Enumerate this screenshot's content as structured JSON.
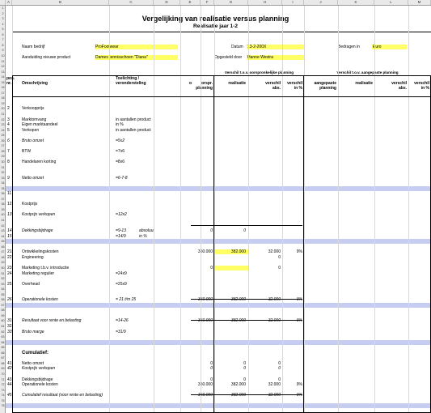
{
  "columns": [
    "A",
    "B",
    "C",
    "D",
    "E",
    "F",
    "G",
    "H",
    "I",
    "J",
    "K",
    "L",
    "M"
  ],
  "title": "Vergelijking van realisatie versus planning",
  "subtitle": "Realisatie jaar 1-2",
  "form": {
    "bedrijf_label": "Naam bedrijf",
    "bedrijf_value": "ProFootwear",
    "product_label": "Aanduiding nieuwe product",
    "product_value": "Dames tennisschoen \"Diana\"",
    "datum_label": "Datum",
    "datum_value": "13-2-200X",
    "opgesteld_label": "Opgesteld door",
    "opgesteld_value": "Hanne Westra",
    "bedragen_label": "Bedragen in",
    "bedragen_value": "Euro"
  },
  "headers": {
    "verschil_oorspr": "Verschil t.o.v. oorspronkelijke planning",
    "verschil_aangepast": "Verschil t.o.v. aangepaste planning",
    "pos": "pos.",
    "nr": "nr.",
    "omschrijving": "Omschrijving",
    "toelichting1": "Toelichting /",
    "toelichting2": "verondersteling",
    "o": "o",
    "orspr1": "orspr.",
    "orspr2": "planning",
    "realisatie": "realisatie",
    "verschil": "verschil",
    "abs": "abs.",
    "in_pct": "in %",
    "aangepaste1": "aangepaste",
    "aangepaste2": "planning"
  },
  "rows": [
    {
      "r": "1"
    },
    {
      "r": "2"
    },
    {
      "r": "3"
    },
    {
      "r": "4"
    },
    {
      "r": "5"
    },
    {
      "r": "6"
    },
    {
      "r": "7"
    },
    {
      "r": "8"
    },
    {
      "r": "9"
    },
    {
      "r": "10"
    },
    {
      "r": "11"
    },
    {
      "r": "12"
    },
    {
      "r": "13"
    },
    {
      "r": "14"
    },
    {
      "r": "15"
    },
    {
      "r": "16"
    },
    {
      "r": "17"
    },
    {
      "r": "18"
    },
    {
      "r": "19"
    },
    {
      "r": "20",
      "pos": "2",
      "desc": "Verkoopprijs"
    },
    {
      "r": "21"
    },
    {
      "r": "22",
      "pos": "3",
      "desc": "Marktomvang",
      "note": "in aantallen product"
    },
    {
      "r": "23",
      "pos": "4",
      "desc": "Eigen marktaandeel",
      "note": "in %"
    },
    {
      "r": "24",
      "pos": "5",
      "desc": "Verkopen",
      "note": "in aantallen product"
    },
    {
      "r": "25"
    },
    {
      "r": "26",
      "pos": "6",
      "desc": "Bruto omzet",
      "formula": "=5x2",
      "italic": true
    },
    {
      "r": "27"
    },
    {
      "r": "28",
      "pos": "7",
      "desc": "BTW",
      "formula": "=7x6"
    },
    {
      "r": "29"
    },
    {
      "r": "30",
      "pos": "8",
      "desc": "Handelaren korting",
      "formula": "=8x6"
    },
    {
      "r": "31"
    },
    {
      "r": "32"
    },
    {
      "r": "33",
      "pos": "9",
      "desc": "Netto omzet",
      "formula": "=6-7-8",
      "italic": true
    },
    {
      "r": "34"
    },
    {
      "r": "35",
      "band": true
    },
    {
      "r": "36",
      "pos": "11"
    },
    {
      "r": "37"
    },
    {
      "r": "38",
      "pos": "12",
      "desc": "Kostprijs"
    },
    {
      "r": "39"
    },
    {
      "r": "40",
      "pos": "13",
      "desc": "Kostprijs verkopen",
      "formula": "=12x2",
      "italic": true
    },
    {
      "r": "41"
    },
    {
      "r": "42"
    },
    {
      "r": "43",
      "pos": "14",
      "desc": "Dekkingsbijdrage",
      "formula": "=9-13",
      "extra": "absoluut",
      "italic": true,
      "f": "0",
      "g": "0"
    },
    {
      "r": "44",
      "pos": "15",
      "formula": "=14/9",
      "extra": "in %",
      "italic": true
    },
    {
      "r": "45",
      "band": true
    },
    {
      "r": "46"
    },
    {
      "r": "47",
      "pos": "21",
      "desc": "Ontwikkelingskosten",
      "f": "350.000",
      "g": "382.000",
      "h": "32.000",
      "i": "9%",
      "yellow": true
    },
    {
      "r": "48",
      "pos": "22",
      "desc": "Engineering",
      "h": "0"
    },
    {
      "r": "49"
    },
    {
      "r": "50",
      "pos": "23",
      "desc": "Marketing t.b.v. introductie",
      "f": "0",
      "h": "0",
      "yellow": true
    },
    {
      "r": "51",
      "pos": "24",
      "desc": "Marketing regulier",
      "formula": "=24x9"
    },
    {
      "r": "52"
    },
    {
      "r": "53",
      "pos": "25",
      "desc": "Overhead",
      "formula": "=25x9"
    },
    {
      "r": "54"
    },
    {
      "r": "55"
    },
    {
      "r": "56",
      "pos": "26",
      "desc": "Operationele kosten",
      "formula": "= 21 t/m 25",
      "italic": true,
      "f": "350.000",
      "g": "382.000",
      "h": "32.000",
      "i": "9%"
    },
    {
      "r": "57",
      "band": true
    },
    {
      "r": "58"
    },
    {
      "r": "59"
    },
    {
      "r": "60",
      "pos": "31",
      "desc": "Resultaat voor rente en belasting",
      "formula": "=14-26",
      "italic": true,
      "f": "-350.000",
      "g": "-382.000",
      "h": "-32.000",
      "i": "9%"
    },
    {
      "r": "61",
      "pos": "32"
    },
    {
      "r": "62",
      "pos": "33",
      "desc": "Bruto marge",
      "formula": "=31/9",
      "italic": true
    },
    {
      "r": "63"
    },
    {
      "r": "64",
      "band": true
    },
    {
      "r": "65"
    },
    {
      "r": "66",
      "desc": "Cumulatief:",
      "bold": true,
      "big": true
    },
    {
      "r": "67"
    },
    {
      "r": "68",
      "pos": "41",
      "desc": "Netto omzet",
      "f": "0",
      "g": "0",
      "h": "0"
    },
    {
      "r": "69",
      "pos": "42",
      "desc": "Kostprijs verkopen",
      "italic": true,
      "f": "0",
      "g": "0",
      "h": "0"
    },
    {
      "r": "70"
    },
    {
      "r": "71",
      "pos": "43",
      "desc": "Dekkingsbijdrage",
      "f": "0",
      "g": "0",
      "h": "0"
    },
    {
      "r": "72",
      "pos": "44",
      "desc": "Operationele kosten",
      "f": "350.000",
      "g": "382.000",
      "h": "32.000",
      "i": "9%"
    },
    {
      "r": "73"
    },
    {
      "r": "74",
      "pos": "45",
      "desc": "Cumulatief resultaat (voor rente en belasting)",
      "italic": true,
      "f": "-350.000",
      "g": "-382.000",
      "h": "-32.000",
      "i": "9%"
    },
    {
      "r": "75"
    },
    {
      "r": "76",
      "band": true
    }
  ]
}
